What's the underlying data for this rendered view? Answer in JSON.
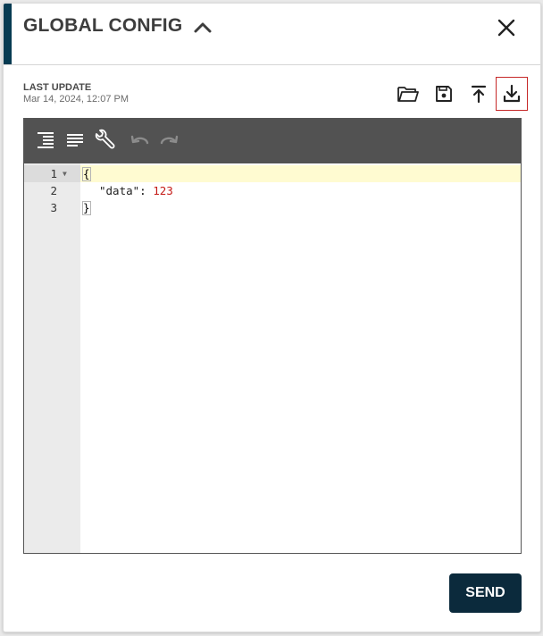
{
  "header": {
    "title": "GLOBAL CONFIG",
    "collapse_icon": "chevron-up-icon",
    "close_icon": "close-icon",
    "accent_color": "#073b52"
  },
  "meta": {
    "last_update_label": "LAST UPDATE",
    "last_update_value": "Mar 14, 2024, 12:07 PM"
  },
  "actions": [
    {
      "icon": "folder-open-icon"
    },
    {
      "icon": "save-icon"
    },
    {
      "icon": "upload-icon"
    },
    {
      "icon": "download-icon",
      "active": true
    }
  ],
  "editor": {
    "toolbar": [
      {
        "icon": "format-json-icon"
      },
      {
        "icon": "compact-json-icon"
      },
      {
        "icon": "repair-json-icon"
      },
      {
        "icon": "undo-icon"
      },
      {
        "icon": "redo-icon"
      }
    ],
    "lines": [
      {
        "num": "1",
        "text": "{"
      },
      {
        "num": "2",
        "key": "\"data\"",
        "sep": ": ",
        "value": "123"
      },
      {
        "num": "3",
        "text": "}"
      }
    ],
    "number_color": "#c41a16",
    "active_line_color": "#fffbd1"
  },
  "footer": {
    "send_label": "SEND",
    "send_color": "#0b2a3c"
  }
}
